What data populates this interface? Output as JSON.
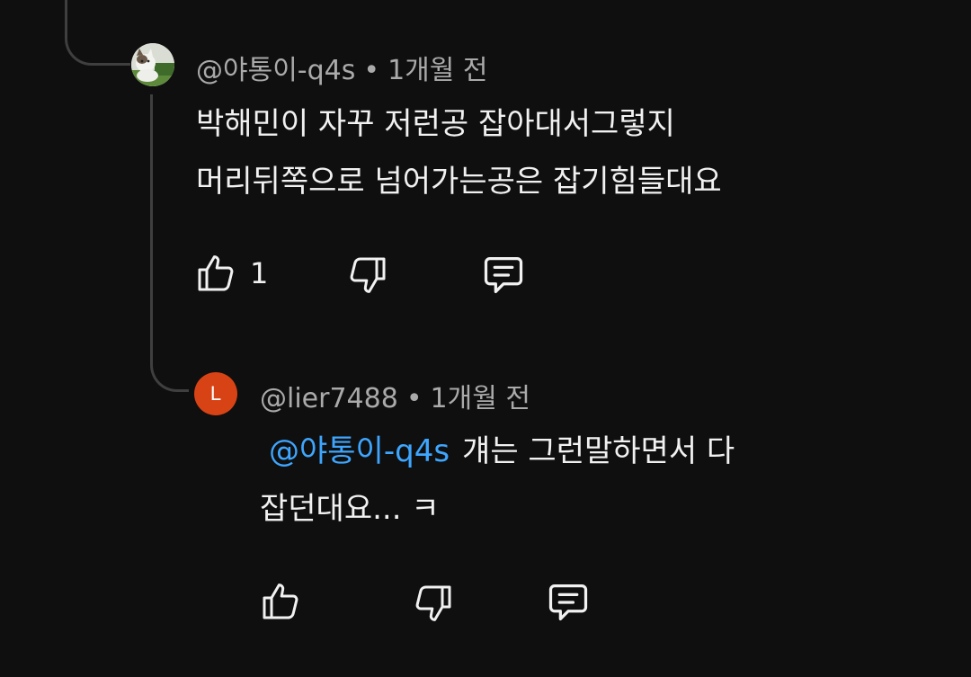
{
  "comments": [
    {
      "author": "@야통이-q4s",
      "separator": "•",
      "time": "1개월 전",
      "lines": [
        "박해민이 자꾸 저런공 잡아대서그렇지",
        "머리뒤쪽으로 넘어가는공은 잡기힘들대요"
      ],
      "like_count": "1",
      "avatar_icon": "cat-photo-avatar"
    },
    {
      "author": "@lier7488",
      "separator": "•",
      "time": "1개월 전",
      "mention": "@야통이-q4s",
      "line1_rest": "걔는 그런말하면서 다",
      "line2": "잡던대요... ㅋ",
      "like_count": "",
      "avatar_letter": "L",
      "avatar_color": "#d84315"
    }
  ],
  "icons": {
    "like": "thumbs-up-icon",
    "dislike": "thumbs-down-icon",
    "reply": "comment-icon"
  },
  "colors": {
    "background": "#0f0f0f",
    "text": "#f1f1f1",
    "meta": "#aaaaaa",
    "mention": "#3ea6ff",
    "thread_line": "#3f3f3f"
  }
}
